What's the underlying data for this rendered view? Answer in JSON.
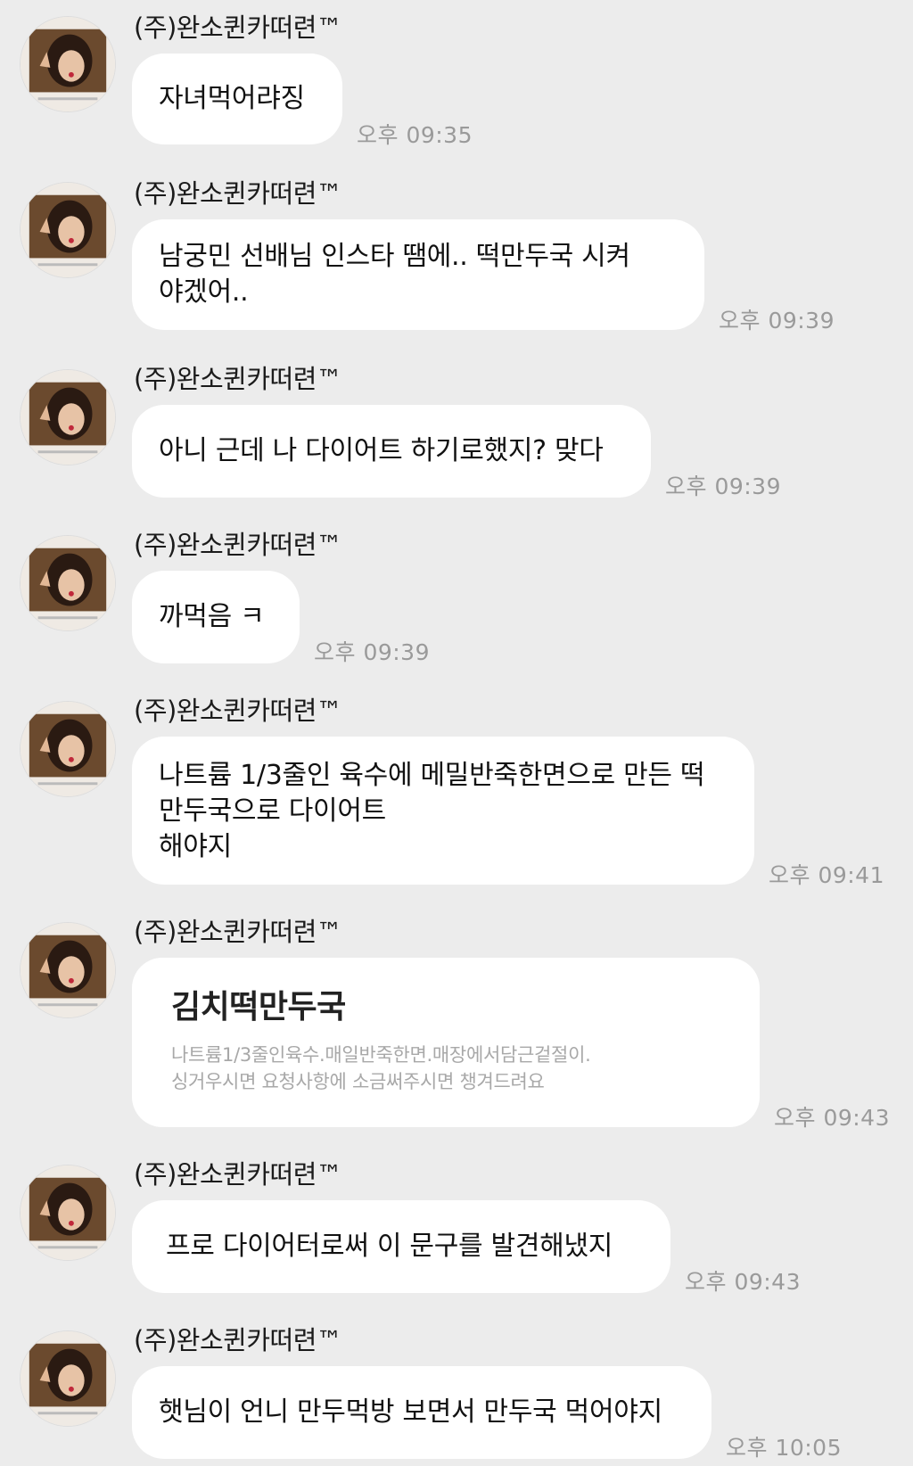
{
  "sender_name": "(주)완소퀸카떠련™",
  "messages": [
    {
      "lines": [
        "자녀먹어랴징"
      ],
      "time": "오후 09:35"
    },
    {
      "lines": [
        "남궁민 선배님 인스타 땜에.. 떡만두국 시켜",
        "야겠어.."
      ],
      "time": "오후 09:39"
    },
    {
      "lines": [
        "아니 근데 나 다이어트 하기로했지? 맞다"
      ],
      "time": "오후 09:39"
    },
    {
      "lines": [
        "까먹음 ㅋ"
      ],
      "time": "오후 09:39"
    },
    {
      "lines": [
        "나트륨 1/3줄인 육수에 메밀반죽한면으로 만든 떡",
        "만두국으로 다이어트",
        "해야지"
      ],
      "time": "오후 09:41"
    },
    {
      "card": {
        "title": "김치떡만두국",
        "desc": [
          "나트륨1/3줄인육수.매일반죽한면.매장에서담근겉절이.",
          "싱거우시면 요청사항에 소금써주시면 챙겨드려요"
        ]
      },
      "time": "오후 09:43"
    },
    {
      "lines": [
        "프로 다이어터로써 이 문구를 발견해냈지"
      ],
      "time": "오후 09:43"
    },
    {
      "lines": [
        "햇님이 언니 만두먹방 보면서 만두국 먹어야지"
      ],
      "time": "오후 10:05"
    }
  ]
}
